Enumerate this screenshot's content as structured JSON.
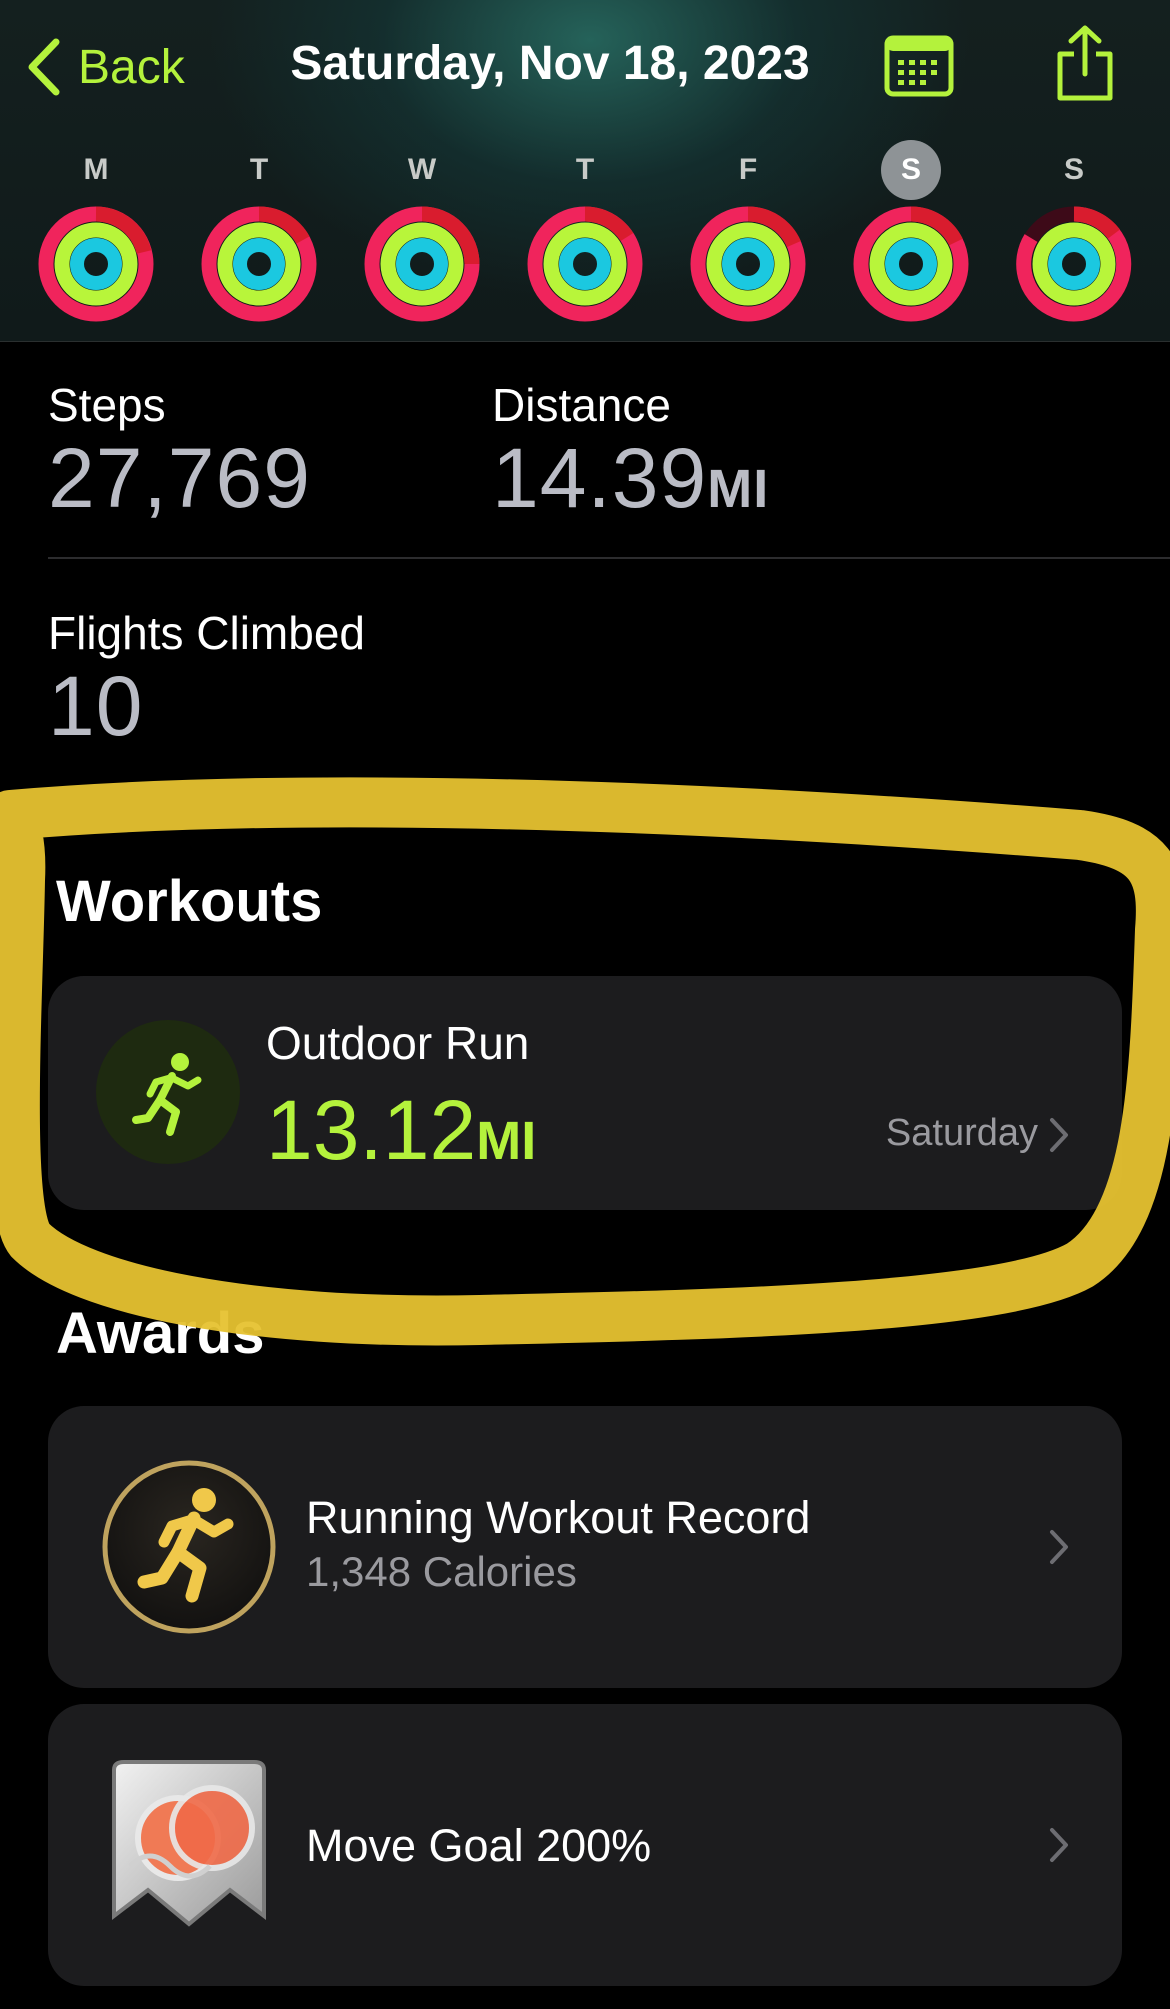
{
  "header": {
    "back_label": "Back",
    "date_title": "Saturday, Nov 18, 2023",
    "icons": {
      "back": "chevron-left-icon",
      "calendar": "calendar-icon",
      "share": "share-icon"
    }
  },
  "week": {
    "days": [
      {
        "letter": "M"
      },
      {
        "letter": "T"
      },
      {
        "letter": "W"
      },
      {
        "letter": "T"
      },
      {
        "letter": "F"
      },
      {
        "letter": "S",
        "selected": true
      },
      {
        "letter": "S"
      }
    ]
  },
  "stats": {
    "steps_label": "Steps",
    "steps_value": "27,769",
    "distance_label": "Distance",
    "distance_value": "14.39",
    "distance_unit": "MI",
    "flights_label": "Flights Climbed",
    "flights_value": "10"
  },
  "workouts": {
    "title": "Workouts",
    "items": [
      {
        "name": "Outdoor Run",
        "distance": "13.12",
        "unit": "MI",
        "day": "Saturday",
        "icon": "running-icon"
      }
    ]
  },
  "awards": {
    "title": "Awards",
    "items": [
      {
        "title": "Running Workout Record",
        "subtitle": "1,348 Calories",
        "icon": "running-award-icon"
      },
      {
        "title": "Move Goal 200%",
        "icon": "move-goal-award-icon"
      }
    ]
  },
  "colors": {
    "accent_green": "#b4f23c",
    "move_ring": "#fa114f",
    "exercise_ring": "#a6ff00",
    "stand_ring": "#00d4e8",
    "highlight_marker": "#e6c230"
  }
}
